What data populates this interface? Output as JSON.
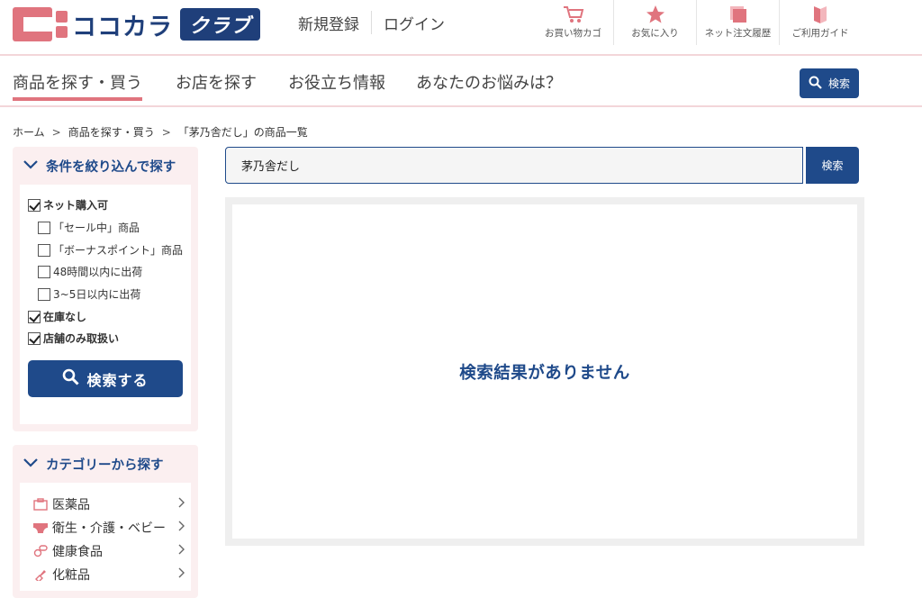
{
  "header": {
    "logo_text": "ココカラ",
    "logo_club": "クラブ",
    "register": "新規登録",
    "login": "ログイン",
    "util": [
      {
        "label": "お買い物カゴ",
        "icon": "cart-icon"
      },
      {
        "label": "お気に入り",
        "icon": "star-icon"
      },
      {
        "label": "ネット注文履歴",
        "icon": "order-history-icon"
      },
      {
        "label": "ご利用ガイド",
        "icon": "guide-book-icon"
      }
    ]
  },
  "nav": {
    "items": [
      "商品を探す・買う",
      "お店を探す",
      "お役立ち情報",
      "あなたのお悩みは？"
    ],
    "active_index": 0,
    "search_label": "検索"
  },
  "breadcrumb": [
    "ホーム",
    "商品を探す・買う",
    "「茅乃舎だし」の商品一覧"
  ],
  "filter": {
    "title": "条件を絞り込んで探す",
    "options": [
      {
        "label": "ネット購入可",
        "checked": true
      },
      {
        "label": "「セール中」商品",
        "checked": false
      },
      {
        "label": "「ボーナスポイント」商品",
        "checked": false
      },
      {
        "label": "48時間以内に出荷",
        "checked": false
      },
      {
        "label": "3~5日以内に出荷",
        "checked": false
      },
      {
        "label": "在庫なし",
        "checked": true
      },
      {
        "label": "店舗のみ取扱い",
        "checked": true
      }
    ],
    "button": "検索する"
  },
  "category": {
    "title": "カテゴリーから探す",
    "items": [
      {
        "label": "医薬品",
        "icon": "medicine-box-icon"
      },
      {
        "label": "衛生・介護・ベビー",
        "icon": "diaper-icon"
      },
      {
        "label": "健康食品",
        "icon": "supplement-icon"
      },
      {
        "label": "化粧品",
        "icon": "lipstick-icon"
      }
    ]
  },
  "search": {
    "value": "茅乃舎だし",
    "button": "検索"
  },
  "results": {
    "empty_message": "検索結果がありません"
  },
  "colors": {
    "brand_navy": "#1f4a8a",
    "brand_pink": "#e0747e",
    "panel_bg": "#fbeff0"
  }
}
